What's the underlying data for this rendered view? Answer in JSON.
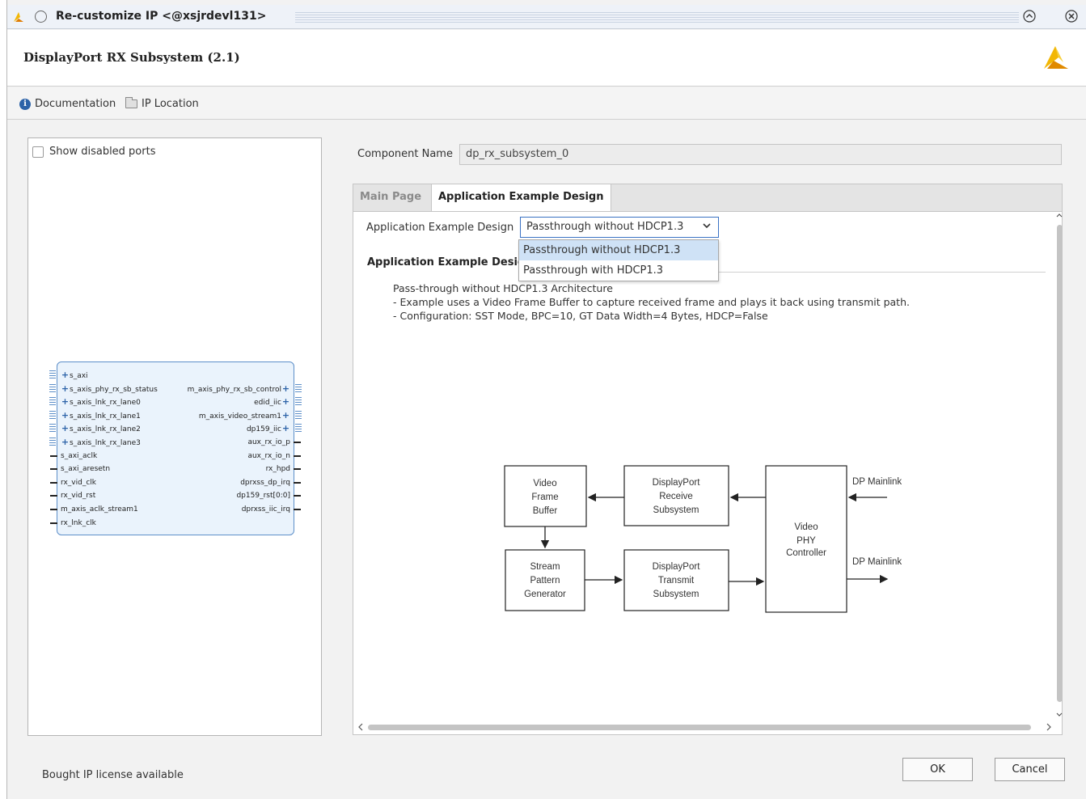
{
  "window": {
    "title": "Re-customize IP <@xsjrdevl131>",
    "restore_glyph": "⌃",
    "close_glyph": "✕"
  },
  "header": {
    "ip_title": "DisplayPort RX Subsystem (2.1)"
  },
  "links": {
    "documentation": "Documentation",
    "ip_location": "IP Location",
    "info_glyph": "i"
  },
  "left_panel": {
    "show_disabled_ports": "Show disabled ports",
    "show_disabled_ports_checked": false,
    "left_ports": [
      {
        "name": "s_axi",
        "kind": "bus"
      },
      {
        "name": "s_axis_phy_rx_sb_status",
        "kind": "bus"
      },
      {
        "name": "s_axis_lnk_rx_lane0",
        "kind": "bus"
      },
      {
        "name": "s_axis_lnk_rx_lane1",
        "kind": "bus"
      },
      {
        "name": "s_axis_lnk_rx_lane2",
        "kind": "bus"
      },
      {
        "name": "s_axis_lnk_rx_lane3",
        "kind": "bus"
      },
      {
        "name": "s_axi_aclk",
        "kind": "pin"
      },
      {
        "name": "s_axi_aresetn",
        "kind": "pin"
      },
      {
        "name": "rx_vid_clk",
        "kind": "pin"
      },
      {
        "name": "rx_vid_rst",
        "kind": "pin"
      },
      {
        "name": "m_axis_aclk_stream1",
        "kind": "pin"
      },
      {
        "name": "rx_lnk_clk",
        "kind": "pin"
      }
    ],
    "right_ports": [
      {
        "name": "m_axis_phy_rx_sb_control",
        "kind": "bus"
      },
      {
        "name": "edid_iic",
        "kind": "bus"
      },
      {
        "name": "m_axis_video_stream1",
        "kind": "bus"
      },
      {
        "name": "dp159_iic",
        "kind": "bus"
      },
      {
        "name": "aux_rx_io_p",
        "kind": "pin"
      },
      {
        "name": "aux_rx_io_n",
        "kind": "pin"
      },
      {
        "name": "rx_hpd",
        "kind": "pin"
      },
      {
        "name": "dprxss_dp_irq",
        "kind": "pin"
      },
      {
        "name": "dp159_rst[0:0]",
        "kind": "pin"
      },
      {
        "name": "dprxss_iic_irq",
        "kind": "pin"
      }
    ]
  },
  "component": {
    "label": "Component Name",
    "value": "dp_rx_subsystem_0"
  },
  "tabs": [
    {
      "label": "Main Page",
      "active": false
    },
    {
      "label": "Application Example Design",
      "active": true
    }
  ],
  "app_design": {
    "label": "Application Example Design",
    "selected": "Passthrough without HDCP1.3",
    "options": [
      "Passthrough without HDCP1.3",
      "Passthrough with HDCP1.3"
    ],
    "section_title": "Application Example Design",
    "description": [
      "Pass-through without HDCP1.3 Architecture",
      "- Example uses a Video Frame Buffer to capture received frame and plays it back using transmit path.",
      "- Configuration: SST Mode, BPC=10, GT Data Width=4 Bytes, HDCP=False"
    ]
  },
  "diagram": {
    "video_frame_buffer": [
      "Video",
      "Frame",
      "Buffer"
    ],
    "dp_receive": [
      "DisplayPort",
      "Receive",
      "Subsystem"
    ],
    "video_phy": [
      "Video",
      "PHY",
      "Controller"
    ],
    "stream_pattern": [
      "Stream",
      "Pattern",
      "Generator"
    ],
    "dp_transmit": [
      "DisplayPort",
      "Transmit",
      "Subsystem"
    ],
    "dp_mainlink_in": "DP Mainlink",
    "dp_mainlink_out": "DP Mainlink"
  },
  "footer": {
    "license_text": "Bought IP license available",
    "ok_label": "OK",
    "cancel_label": "Cancel"
  },
  "colors": {
    "accent": "#3a72c4",
    "ip_block_fill": "#eaf3fc",
    "ip_block_border": "#5d8fc9",
    "dropdown_highlight": "#cfe2f6"
  }
}
